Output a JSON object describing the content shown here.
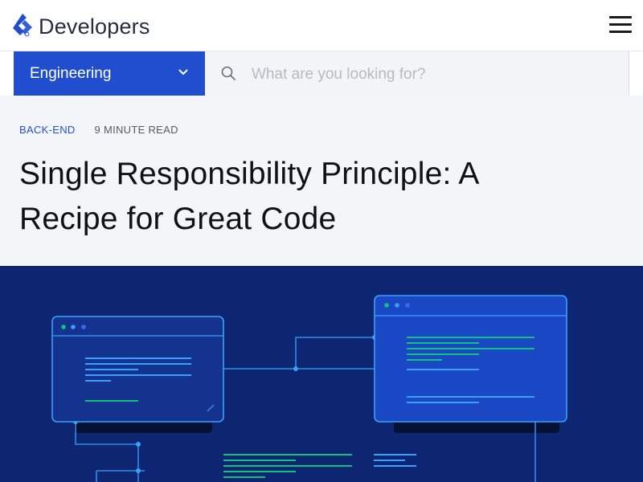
{
  "header": {
    "logo_text": "Developers",
    "logo_icon": "toptal-logo-icon",
    "menu_icon": "hamburger-menu-icon"
  },
  "toolbar": {
    "category_label": "Engineering",
    "category_icon": "chevron-down-icon",
    "search_icon": "search-icon",
    "search_placeholder": "What are you looking for?"
  },
  "article": {
    "category": "BACK-END",
    "read_time": "9 MINUTE READ",
    "title": "Single Responsibility Principle: A Recipe for Great Code"
  },
  "hero": {
    "background_color": "#0e2572",
    "accent_green": "#10c37a",
    "accent_blue": "#3aa0ff"
  },
  "colors": {
    "brand_blue": "#204ecf",
    "header_text": "#262d3d",
    "article_bg": "#f3f5f8"
  }
}
